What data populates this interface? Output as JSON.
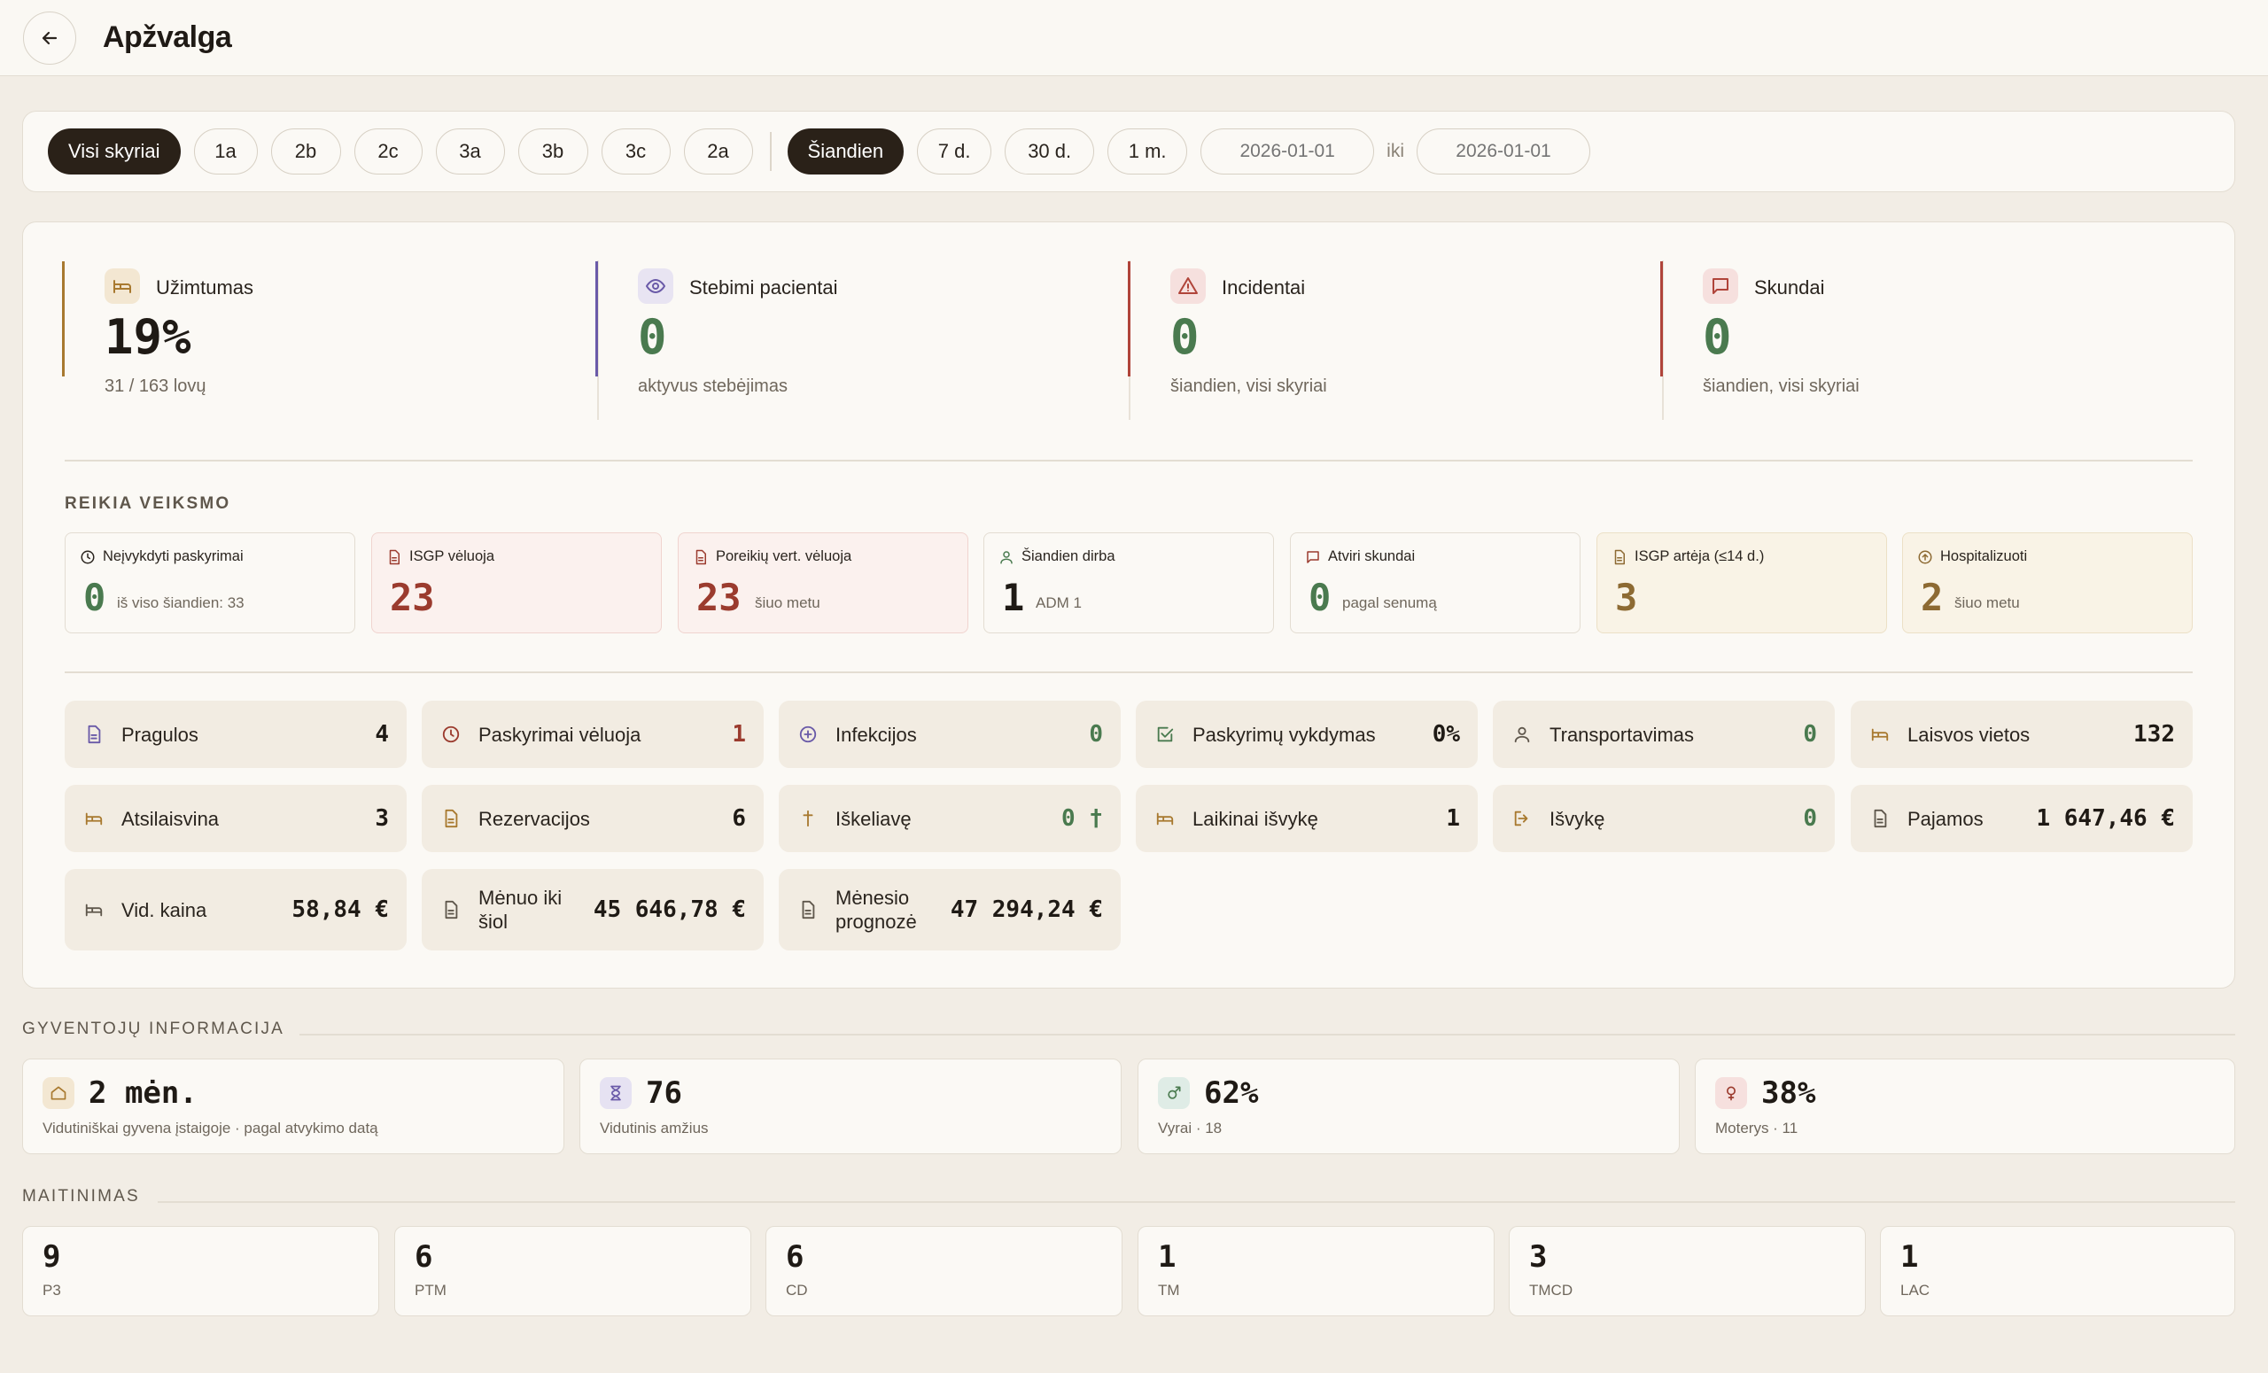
{
  "header": {
    "title": "Apžvalga"
  },
  "filters": {
    "departments": [
      "Visi skyriai",
      "1a",
      "2b",
      "2c",
      "3a",
      "3b",
      "3c",
      "2a"
    ],
    "periods": [
      "Šiandien",
      "7 d.",
      "30 d.",
      "1 m."
    ],
    "date_from": "2026-01-01",
    "date_sep": "iki",
    "date_to": "2026-01-01"
  },
  "kpis": [
    {
      "label": "Užimtumas",
      "value": "19%",
      "sub": "31 / 163 lovų",
      "icon": "bed-icon",
      "accent": "#a8792f"
    },
    {
      "label": "Stebimi pacientai",
      "value": "0",
      "sub": "aktyvus stebėjimas",
      "icon": "eye-icon",
      "accent": "#6a5aa8"
    },
    {
      "label": "Incidentai",
      "value": "0",
      "sub": "šiandien, visi skyriai",
      "icon": "warning-icon",
      "accent": "#b0443a"
    },
    {
      "label": "Skundai",
      "value": "0",
      "sub": "šiandien, visi skyriai",
      "icon": "message-icon",
      "accent": "#b0443a"
    }
  ],
  "action": {
    "title": "REIKIA VEIKSMO",
    "cards": [
      {
        "label": "Neįvykdyti paskyrimai",
        "value": "0",
        "sub": "iš viso šiandien: 33",
        "icon": "clock-icon",
        "tone": "green"
      },
      {
        "label": "ISGP vėluoja",
        "value": "23",
        "sub": "",
        "icon": "document-icon",
        "tone": "red"
      },
      {
        "label": "Poreikių vert. vėluoja",
        "value": "23",
        "sub": "šiuo metu",
        "icon": "document-icon",
        "tone": "red"
      },
      {
        "label": "Šiandien dirba",
        "value": "1",
        "sub": "ADM 1",
        "icon": "person-icon",
        "tone": "dark"
      },
      {
        "label": "Atviri skundai",
        "value": "0",
        "sub": "pagal senumą",
        "icon": "message-icon",
        "tone": "green"
      },
      {
        "label": "ISGP artėja (≤14 d.)",
        "value": "3",
        "sub": "",
        "icon": "document-icon",
        "tone": "amber"
      },
      {
        "label": "Hospitalizuoti",
        "value": "2",
        "sub": "šiuo metu",
        "icon": "arrow-up-circle-icon",
        "tone": "amber"
      }
    ]
  },
  "stats": [
    {
      "label": "Pragulos",
      "value": "4",
      "icon": "document-icon",
      "tone": "dark"
    },
    {
      "label": "Paskyrimai vėluoja",
      "value": "1",
      "icon": "clock-icon",
      "tone": "red"
    },
    {
      "label": "Infekcijos",
      "value": "0",
      "icon": "plus-circle-icon",
      "tone": "green"
    },
    {
      "label": "Paskyrimų vykdymas",
      "value": "0%",
      "icon": "check-square-icon",
      "tone": "dark"
    },
    {
      "label": "Transportavimas",
      "value": "0",
      "icon": "person-icon",
      "tone": "green"
    },
    {
      "label": "Laisvos vietos",
      "value": "132",
      "icon": "bed-icon",
      "tone": "dark"
    },
    {
      "label": "Atsilaisvina",
      "value": "3",
      "icon": "bed-icon",
      "tone": "dark"
    },
    {
      "label": "Rezervacijos",
      "value": "6",
      "icon": "document-icon",
      "tone": "dark"
    },
    {
      "label": "Iškeliavę",
      "value": "0 †",
      "icon": "cross-icon",
      "tone": "green"
    },
    {
      "label": "Laikinai išvykę",
      "value": "1",
      "icon": "bed-icon",
      "tone": "dark"
    },
    {
      "label": "Išvykę",
      "value": "0",
      "icon": "exit-icon",
      "tone": "green"
    },
    {
      "label": "Pajamos",
      "value": "1 647,46 €",
      "icon": "document-icon",
      "tone": "dark"
    },
    {
      "label": "Vid. kaina",
      "value": "58,84 €",
      "icon": "bed-icon",
      "tone": "dark"
    },
    {
      "label": "Mėnuo iki šiol",
      "value": "45 646,78 €",
      "icon": "document-icon",
      "tone": "dark"
    },
    {
      "label": "Mėnesio prognozė",
      "value": "47 294,24 €",
      "icon": "document-icon",
      "tone": "dark"
    }
  ],
  "residents": {
    "title": "GYVENTOJŲ INFORMACIJA",
    "items": [
      {
        "value": "2 mėn.",
        "sub": "Vidutiniškai gyvena įstaigoje · pagal atvykimo datą",
        "icon": "home-icon",
        "color": "#f3e7d2"
      },
      {
        "value": "76",
        "sub": "Vidutinis amžius",
        "icon": "hourglass-icon",
        "color": "#e6e2f2"
      },
      {
        "value": "62%",
        "sub": "Vyrai · 18",
        "icon": "male-icon",
        "color": "#dfece6"
      },
      {
        "value": "38%",
        "sub": "Moterys · 11",
        "icon": "female-icon",
        "color": "#f6e0de"
      }
    ]
  },
  "nutrition": {
    "title": "MAITINIMAS",
    "items": [
      {
        "value": "9",
        "label": "P3"
      },
      {
        "value": "6",
        "label": "PTM"
      },
      {
        "value": "6",
        "label": "CD"
      },
      {
        "value": "1",
        "label": "TM"
      },
      {
        "value": "3",
        "label": "TMCD"
      },
      {
        "value": "1",
        "label": "LAC"
      }
    ]
  }
}
